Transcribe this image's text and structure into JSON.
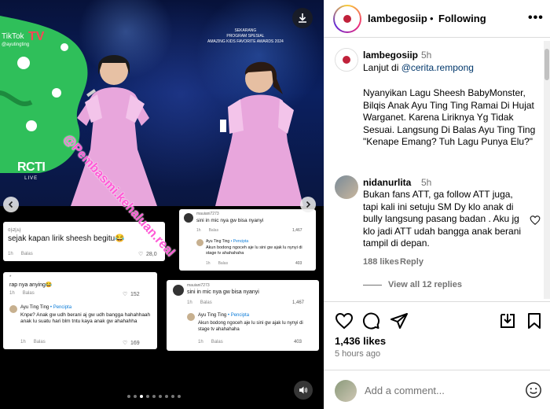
{
  "header": {
    "username": "lambegosiip",
    "separator": "•",
    "follow_status": "Following",
    "more": "•••"
  },
  "caption": {
    "username": "lambegosiip",
    "time": "5h",
    "lanjut_prefix": "Lanjut di ",
    "mention": "@cerita.rempong",
    "body": "Nyanyikan Lagu Sheesh BabyMonster, Bilqis Anak Ayu Ting Ting Ramai Di Hujat Warganet. Karena Liriknya Yg Tidak Sesuai. Langsung Di Balas Ayu Ting Ting \"Kenape Emang? Tuh Lagu Punya Elu?\""
  },
  "comment": {
    "username": "nidanurlita",
    "time": "5h",
    "body": "Bukan fans ATT, ga follow ATT juga, tapi kali ini setuju SM Dy klo anak di bully langsung pasang badan . Aku jg klo jadi ATT udah bangga anak berani tampil di depan.",
    "likes": "188 likes",
    "reply": "Reply",
    "view_replies": "View all 12 replies"
  },
  "actions": {
    "likes": "1,436 likes",
    "time": "5 hours ago"
  },
  "add_comment": {
    "placeholder": "Add a comment..."
  },
  "media": {
    "watermark": "@Pembasmi.kehaluan.real",
    "tiktok": "TikTok",
    "tiktok_handle": "@ayutingting",
    "tv": "TV",
    "rcti": "RCTI",
    "rcti_live": "LIVE",
    "award_line1": "SEKARANG",
    "award_line2": "PROGRAM SPESIAL",
    "award_line3": "AMAZING KIDS FAVORITE AWARDS 2024",
    "carousel_total": 9,
    "carousel_active": 2
  },
  "cards": {
    "card1": {
      "user": "아리사",
      "text": "sejak kapan lirik sheesh begitu😂",
      "time": "1h",
      "reply": "Balas",
      "likes": "28,0"
    },
    "card2": {
      "user": "mauiani7273",
      "text": "sini in mic nya gw bisa nyanyi",
      "time": "1h",
      "reply": "Balas",
      "likes": "1,467",
      "reply_author": "Ayu Ting Ting",
      "creator": "• Pencipta",
      "reply_text": "Akun bodong ngoceh aje lu sini gw ajak lu nynyi di stage tv ahahahaha",
      "reply_time": "1h",
      "reply_reply": "Balas",
      "reply_likes": "403"
    },
    "card3": {
      "user": "*",
      "text": "rap nya anying😂",
      "time": "1h",
      "reply": "Balas",
      "likes": "152",
      "reply_author": "Ayu Ting Ting",
      "creator": "• Pencipta",
      "reply_text": "Knpe? Anak gw udh berani aj gw udh bangga hahahhaah anak lu suatu hari blm tntu kaya anak gw ahahahha",
      "reply_time": "1h",
      "reply_reply": "Balas",
      "reply_likes": "169"
    },
    "card4": {
      "user": "mauiani7273",
      "text": "sini in mic nya gw bisa nyanyi",
      "time": "1h",
      "reply": "Balas",
      "likes": "1,467",
      "reply_author": "Ayu Ting Ting",
      "creator": "• Pencipta",
      "reply_text": "Akun bodong ngoceh aje lu sini gw ajak lu nynyi di stage tv ahahahaha",
      "reply_time": "1h",
      "reply_reply": "Balas",
      "reply_likes": "403"
    }
  },
  "colors": {
    "accent_link": "#00376b",
    "muted": "#737373",
    "watermark": "#ff5ad6"
  }
}
